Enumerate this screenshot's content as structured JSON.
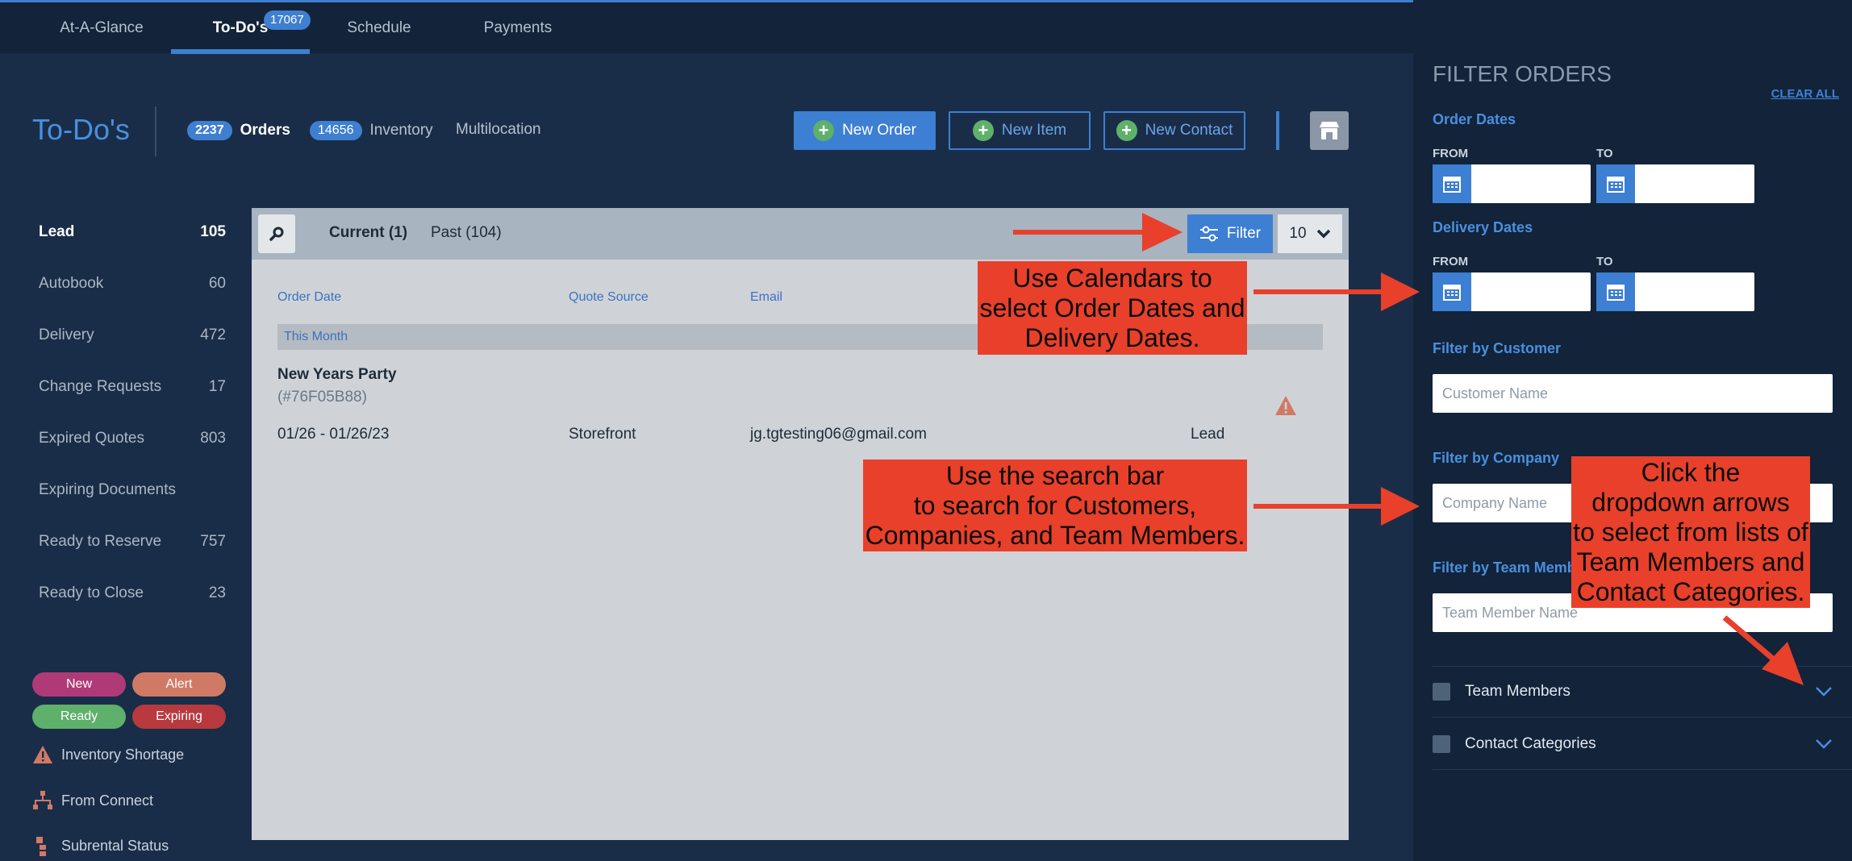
{
  "nav": {
    "tabs": [
      {
        "label": "At-A-Glance"
      },
      {
        "label": "To-Do's",
        "badge": "17067",
        "active": true
      },
      {
        "label": "Schedule"
      },
      {
        "label": "Payments"
      }
    ]
  },
  "header": {
    "title": "To-Do's",
    "orders_count": "2237",
    "orders_label": "Orders",
    "inventory_count": "14656",
    "inventory_label": "Inventory",
    "multilocation_label": "Multilocation",
    "new_order": "New Order",
    "new_item": "New Item",
    "new_contact": "New Contact"
  },
  "sidebar": {
    "items": [
      {
        "label": "Lead",
        "count": "105",
        "active": true
      },
      {
        "label": "Autobook",
        "count": "60"
      },
      {
        "label": "Delivery",
        "count": "472"
      },
      {
        "label": "Change Requests",
        "count": "17"
      },
      {
        "label": "Expired Quotes",
        "count": "803"
      },
      {
        "label": "Expiring Documents",
        "count": ""
      },
      {
        "label": "Ready to Reserve",
        "count": "757"
      },
      {
        "label": "Ready to Close",
        "count": "23"
      }
    ],
    "legend": {
      "new": "New",
      "alert": "Alert",
      "ready": "Ready",
      "expiring": "Expiring"
    },
    "legend_colors": {
      "new": "#b03a78",
      "alert": "#d07a66",
      "ready": "#5fb06b",
      "expiring": "#b8393e"
    },
    "status": {
      "inventory_shortage": "Inventory Shortage",
      "from_connect": "From Connect",
      "subrental_status": "Subrental Status"
    }
  },
  "panel": {
    "current_tab": "Current (1)",
    "past_tab": "Past (104)",
    "filter_label": "Filter",
    "per_page": "10",
    "columns": {
      "order_date": "Order Date",
      "quote_source": "Quote Source",
      "email": "Email"
    },
    "group": "This Month",
    "order": {
      "name": "New Years Party",
      "id": "(#76F05B88)",
      "dates": "01/26 - 01/26/23",
      "source": "Storefront",
      "email": "jg.tgtesting06@gmail.com",
      "status": "Lead"
    }
  },
  "filter": {
    "title": "FILTER ORDERS",
    "clear_all": "CLEAR ALL",
    "order_dates": "Order Dates",
    "delivery_dates": "Delivery Dates",
    "from": "FROM",
    "to": "TO",
    "by_customer": "Filter by Customer",
    "customer_placeholder": "Customer Name",
    "by_company": "Filter by Company",
    "company_placeholder": "Company Name",
    "by_team_member": "Filter by Team Member",
    "team_member_placeholder": "Team Member Name",
    "team_members": "Team Members",
    "contact_categories": "Contact Categories"
  },
  "annotations": {
    "calendars": "Use Calendars to\nselect Order Dates and\nDelivery Dates.",
    "search": "Use the search bar\nto search for Customers,\nCompanies, and Team Members.",
    "dropdown": "Click the\ndropdown arrows\nto select from lists of\nTeam Members and\nContact Categories."
  },
  "colors": {
    "accent": "#3d7fd2",
    "callout": "#e8402a"
  }
}
